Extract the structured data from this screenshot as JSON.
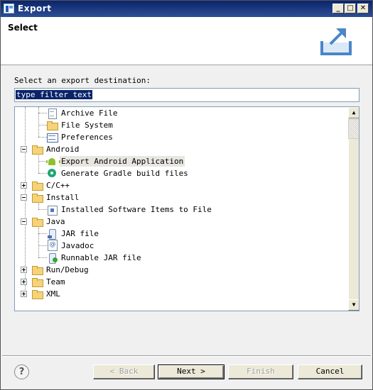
{
  "window": {
    "title": "Export"
  },
  "header": {
    "heading": "Select"
  },
  "instruction": "Select an export destination:",
  "filter": {
    "value": "type filter text"
  },
  "tree": {
    "items": [
      {
        "label": "Archive File",
        "icon": "archive-file-icon"
      },
      {
        "label": "File System",
        "icon": "folder-icon"
      },
      {
        "label": "Preferences",
        "icon": "preferences-icon"
      },
      {
        "label": "Android",
        "icon": "folder-icon"
      },
      {
        "label": "Export Android Application",
        "icon": "android-icon",
        "selected": true
      },
      {
        "label": "Generate Gradle build files",
        "icon": "gradle-icon"
      },
      {
        "label": "C/C++",
        "icon": "folder-icon"
      },
      {
        "label": "Install",
        "icon": "folder-icon"
      },
      {
        "label": "Installed Software Items to File",
        "icon": "install-icon"
      },
      {
        "label": "Java",
        "icon": "folder-icon"
      },
      {
        "label": "JAR file",
        "icon": "jar-icon"
      },
      {
        "label": "Javadoc",
        "icon": "javadoc-icon"
      },
      {
        "label": "Runnable JAR file",
        "icon": "runnable-jar-icon"
      },
      {
        "label": "Run/Debug",
        "icon": "folder-icon"
      },
      {
        "label": "Team",
        "icon": "folder-icon"
      },
      {
        "label": "XML",
        "icon": "folder-icon"
      }
    ]
  },
  "buttons": {
    "back": "< Back",
    "next": "Next >",
    "finish": "Finish",
    "cancel": "Cancel"
  },
  "help": {
    "glyph": "?"
  },
  "window_controls": {
    "minimize": "_",
    "maximize": "□",
    "close": "✕"
  }
}
